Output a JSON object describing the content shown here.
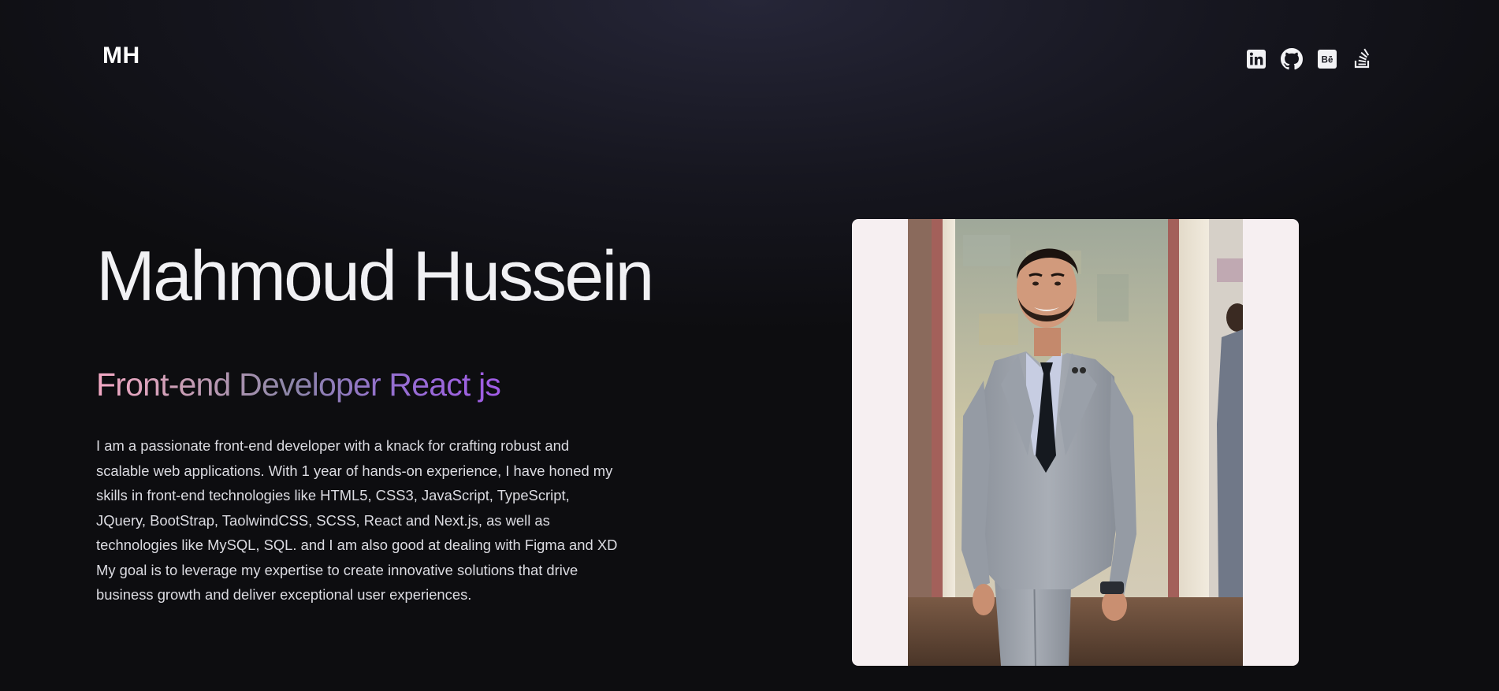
{
  "header": {
    "logo": "MH",
    "social_links": [
      {
        "name": "linkedin-icon"
      },
      {
        "name": "github-icon"
      },
      {
        "name": "behance-icon"
      },
      {
        "name": "stackoverflow-icon"
      }
    ]
  },
  "hero": {
    "name": "Mahmoud Hussein",
    "role": "Front-end Developer React js",
    "bio_lines": [
      "I am a passionate front-end developer with a knack for crafting robust and",
      "scalable web applications. With 1 year of hands-on experience, I have honed my",
      "skills in front-end technologies like HTML5, CSS3, JavaScript, TypeScript,",
      "JQuery, BootStrap, TaolwindCSS, SCSS, React and Next.js, as well as",
      "technologies like MySQL, SQL. and I am also good at dealing with Figma and XD",
      "My goal is to leverage my expertise to create innovative solutions that drive",
      "business growth and deliver exceptional user experiences."
    ]
  },
  "photo": {
    "subject": "portrait-photo",
    "card_color": "#f6eff1"
  },
  "colors": {
    "background": "#0f0f12",
    "text": "#f1f1f4",
    "role_gradient_start": "#f4a9c5",
    "role_gradient_end": "#a05be6"
  }
}
